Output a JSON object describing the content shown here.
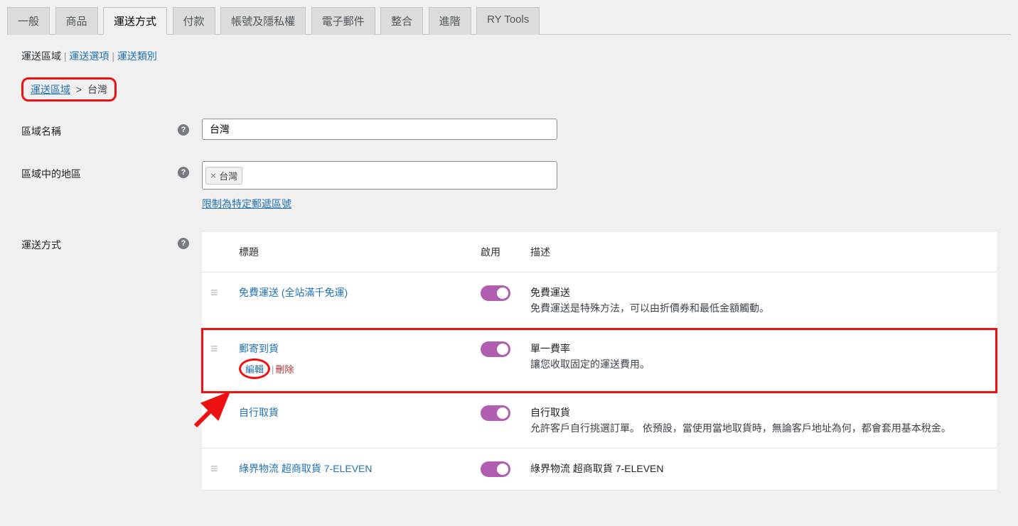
{
  "tabs": [
    "一般",
    "商品",
    "運送方式",
    "付款",
    "帳號及隱私權",
    "電子郵件",
    "整合",
    "進階",
    "RY Tools"
  ],
  "active_tab_index": 2,
  "sub_nav": {
    "current": "運送區域",
    "links": [
      "運送選項",
      "運送類別"
    ]
  },
  "breadcrumb": {
    "root": "運送區域",
    "sep": ">",
    "current": "台灣"
  },
  "zone_name": {
    "label": "區域名稱",
    "value": "台灣"
  },
  "zone_regions": {
    "label": "區域中的地區",
    "tags": [
      "台灣"
    ],
    "restrict_link": "限制為特定郵遞區號"
  },
  "shipping_methods": {
    "label": "運送方式",
    "headers": {
      "title": "標題",
      "enabled": "啟用",
      "description": "描述"
    },
    "rows": [
      {
        "title": "免費運送 (全站滿千免運)",
        "enabled": true,
        "desc_title": "免費運送",
        "desc_text": "免費運送是特殊方法，可以由折價券和最低金額觸動。",
        "show_actions": false
      },
      {
        "title": "郵寄到貨",
        "enabled": true,
        "desc_title": "單一費率",
        "desc_text": "讓您收取固定的運送費用。",
        "show_actions": true,
        "edit_label": "編輯",
        "delete_label": "刪除",
        "highlight": true
      },
      {
        "title": "自行取貨",
        "enabled": true,
        "desc_title": "自行取貨",
        "desc_text": "允許客戶自行挑選訂單。 依預設，當使用當地取貨時，無論客戶地址為何，都會套用基本稅金。",
        "show_actions": false
      },
      {
        "title": "綠界物流 超商取貨 7-ELEVEN",
        "enabled": true,
        "desc_title": "綠界物流 超商取貨 7-ELEVEN",
        "desc_text": "",
        "show_actions": false
      }
    ]
  }
}
